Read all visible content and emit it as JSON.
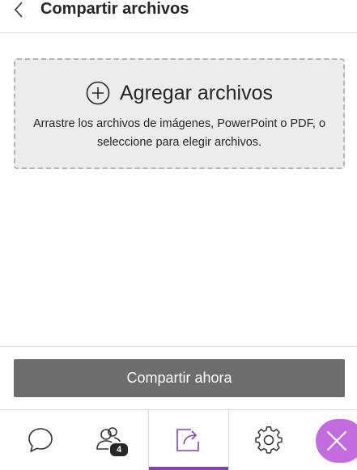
{
  "header": {
    "back_icon": "chevron-left-icon",
    "title": "Compartir archivos"
  },
  "dropzone": {
    "icon": "plus-circle-icon",
    "label": "Agregar archivos",
    "help_text": "Arrastre los archivos de imágenes, PowerPoint o PDF, o seleccione para elegir archivos."
  },
  "share_button": {
    "label": "Compartir ahora"
  },
  "tabbar": {
    "tabs": [
      {
        "id": "chat",
        "icon": "chat-bubble-icon",
        "active": false
      },
      {
        "id": "attendees",
        "icon": "people-icon",
        "badge": "4",
        "active": false
      },
      {
        "id": "share-content",
        "icon": "share-icon",
        "active": true
      },
      {
        "id": "settings",
        "icon": "gear-icon",
        "active": false
      }
    ],
    "close_icon": "close-icon"
  },
  "colors": {
    "accent": "#8a3db5",
    "close_fab": "#c56be0",
    "share_button_bg": "#6d6d6d",
    "dropzone_bg": "#ececec"
  }
}
